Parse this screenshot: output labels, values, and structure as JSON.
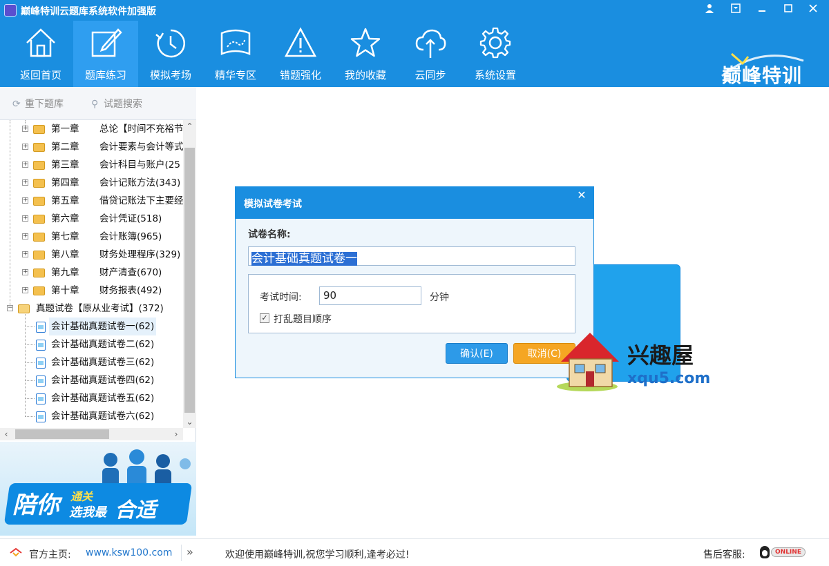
{
  "window": {
    "title": "巅峰特训云题库系统软件加强版",
    "controls": [
      "user-icon",
      "skin-icon",
      "minimize-icon",
      "maximize-icon",
      "close-icon"
    ]
  },
  "toolbar": {
    "items": [
      {
        "label": "返回首页",
        "icon": "home-icon"
      },
      {
        "label": "题库练习",
        "icon": "edit-icon",
        "active": true
      },
      {
        "label": "模拟考场",
        "icon": "clock-icon"
      },
      {
        "label": "精华专区",
        "icon": "map-icon"
      },
      {
        "label": "错题强化",
        "icon": "warning-icon"
      },
      {
        "label": "我的收藏",
        "icon": "star-icon"
      },
      {
        "label": "云同步",
        "icon": "cloud-sync-icon"
      },
      {
        "label": "系统设置",
        "icon": "gear-icon"
      }
    ],
    "brand": "巅峰特训"
  },
  "left_toolbar": {
    "reload": "重下题库",
    "search": "试题搜索"
  },
  "tree": {
    "chapters": [
      {
        "name": "第一章",
        "title": "总论【时间不充裕节"
      },
      {
        "name": "第二章",
        "title": "会计要素与会计等式"
      },
      {
        "name": "第三章",
        "title": "会计科目与账户(25"
      },
      {
        "name": "第四章",
        "title": "会计记账方法(343)"
      },
      {
        "name": "第五章",
        "title": "借贷记账法下主要经"
      },
      {
        "name": "第六章",
        "title": "会计凭证(518)"
      },
      {
        "name": "第七章",
        "title": "会计账簿(965)"
      },
      {
        "name": "第八章",
        "title": "财务处理程序(329)"
      },
      {
        "name": "第九章",
        "title": "财产清查(670)"
      },
      {
        "name": "第十章",
        "title": "财务报表(492)"
      }
    ],
    "group": "真题试卷【原从业考试】(372)",
    "papers": [
      {
        "title": "会计基础真题试卷一(62)",
        "selected": true
      },
      {
        "title": "会计基础真题试卷二(62)"
      },
      {
        "title": "会计基础真题试卷三(62)"
      },
      {
        "title": "会计基础真题试卷四(62)"
      },
      {
        "title": "会计基础真题试卷五(62)"
      },
      {
        "title": "会计基础真题试卷六(62)"
      }
    ]
  },
  "banner": {
    "t1": "陪你",
    "t2": "通关",
    "t3": "选我最",
    "t4": "合适"
  },
  "dialog": {
    "title": "模拟试卷考试",
    "name_label": "试卷名称:",
    "name_value": "会计基础真题试卷一",
    "time_label": "考试时间:",
    "time_value": "90",
    "time_unit": "分钟",
    "shuffle_label": "打乱题目顺序",
    "shuffle_checked": true,
    "ok": "确认(E)",
    "cancel": "取消(C)"
  },
  "watermark": {
    "name": "兴趣屋",
    "url": "xqu5.com"
  },
  "statusbar": {
    "home_label": "官方主页:",
    "home_url": "www.ksw100.com",
    "welcome": "欢迎使用巅峰特训,祝您学习顺利,逢考必过!",
    "service_label": "售后客服:",
    "online": "ONLINE"
  },
  "colors": {
    "primary": "#1a8ee0",
    "active_tab": "#2f9ef0",
    "ok_button": "#2d9ae8",
    "cancel_button": "#f5a623"
  }
}
